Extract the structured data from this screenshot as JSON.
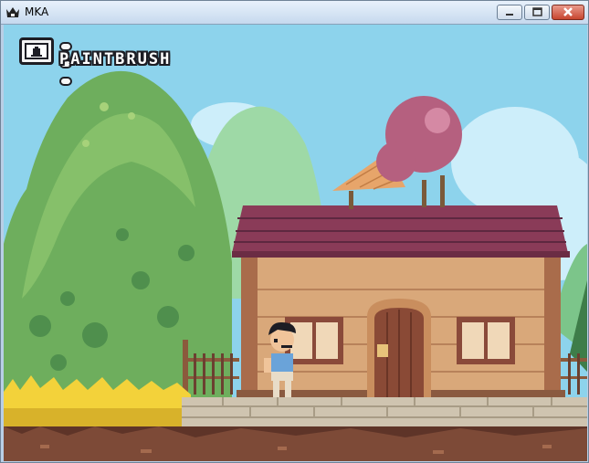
{
  "window": {
    "title": "MKA",
    "icon": "crown-icon",
    "controls": [
      "minimize-icon",
      "maximize-icon",
      "close-icon"
    ]
  },
  "hud": {
    "tool_icon": "paint-bucket-icon",
    "tool_name": "PAINTBRUSH",
    "charges": 3
  },
  "scene": {
    "sky_color": "#8dd3ec",
    "hill_color": "#6eae5d",
    "house_wall_color": "#d9a87a",
    "roof_color": "#8a3b58",
    "ice_cream_scoop_color": "#b5607f",
    "grass_color": "#f3d23a",
    "path_color": "#cfc4b0",
    "soil_color": "#7d4a37"
  }
}
